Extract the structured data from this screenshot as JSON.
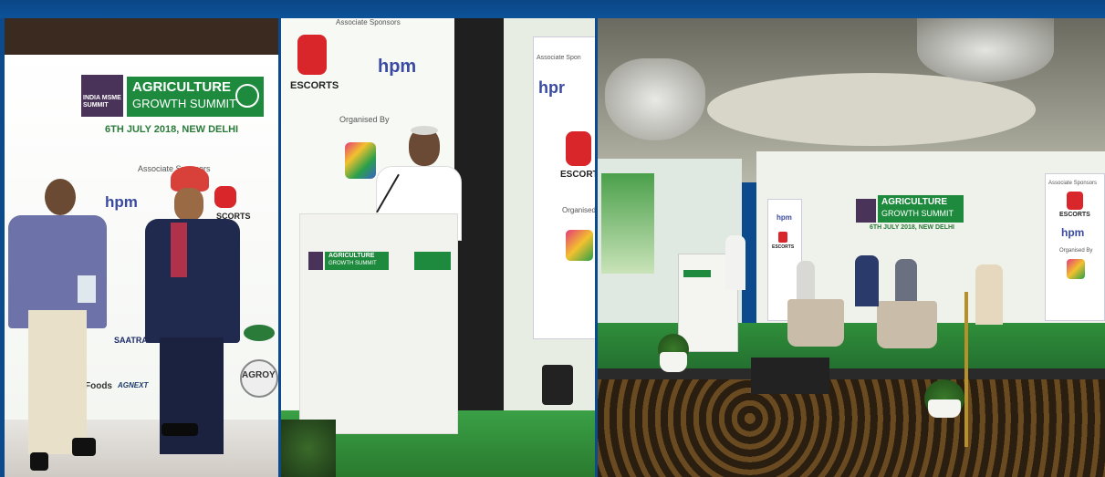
{
  "photos": [
    {
      "banner": {
        "india_msme": "INDIA MSME SUMMIT",
        "title_line1": "AGRICULTURE",
        "title_line2": "GROWTH SUMMIT",
        "date_th": "6TH JULY 2018, NEW DELHI"
      },
      "associate_sponsors": "Associate Sponsors",
      "sponsor_hpm": "hpm",
      "sponsor_escorts": "SCORTS",
      "partners": [
        "SAATRA Capital",
        "Foods",
        "AGNEXT",
        "AGROY"
      ]
    },
    {
      "top_label": "Associate Sponsors",
      "sponsor_escorts": "ESCORTS",
      "sponsor_hpm": "hpm",
      "organised_by": "Organised By",
      "right_label": "Associate Spon",
      "right_hpm": "hpr",
      "right_escorts": "ESCORT",
      "right_organised": "Organised",
      "podium_title_1": "AGRICULTURE",
      "podium_title_2": "GROWTH SUMMIT"
    },
    {
      "banner_title_1": "AGRICULTURE",
      "banner_title_2": "GROWTH SUMMIT",
      "banner_date": "6TH JULY 2018, NEW DELHI",
      "side_hpm": "hpm",
      "side_escorts": "ESCORTS",
      "right_sponsors": "Associate Sponsors",
      "right_escorts": "ESCORTS",
      "right_hpm": "hpm",
      "right_organised": "Organised By"
    }
  ],
  "colors": {
    "frame": "#0b4a8c",
    "green": "#1e8a3e",
    "escorts_red": "#d8262a",
    "stage_green": "#2f8f3a"
  }
}
